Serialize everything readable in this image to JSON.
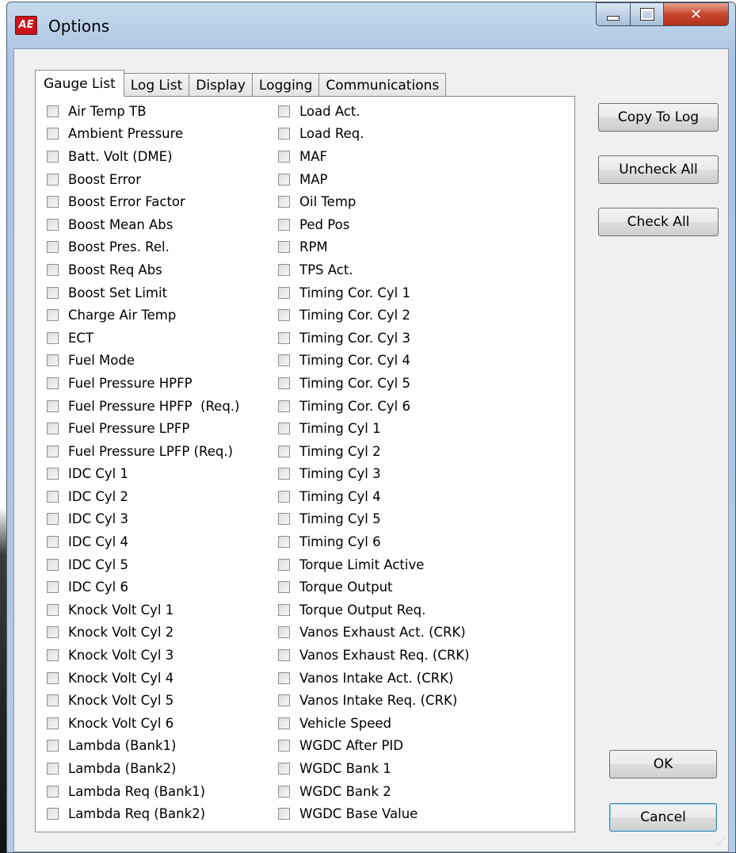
{
  "window": {
    "title": "Options",
    "icon_text": "AE"
  },
  "tabs": [
    "Gauge List",
    "Log List",
    "Display",
    "Logging",
    "Communications"
  ],
  "gauges_col1": [
    "Air Temp TB",
    "Ambient Pressure",
    "Batt. Volt (DME)",
    "Boost Error",
    "Boost Error Factor",
    "Boost Mean Abs",
    "Boost Pres. Rel.",
    "Boost Req Abs",
    "Boost Set Limit",
    "Charge Air Temp",
    "ECT",
    "Fuel Mode",
    "Fuel Pressure HPFP",
    "Fuel Pressure HPFP  (Req.)",
    "Fuel Pressure LPFP",
    "Fuel Pressure LPFP (Req.)",
    "IDC Cyl 1",
    "IDC Cyl 2",
    "IDC Cyl 3",
    "IDC Cyl 4",
    "IDC Cyl 5",
    "IDC Cyl 6",
    "Knock Volt Cyl 1",
    "Knock Volt Cyl 2",
    "Knock Volt Cyl 3",
    "Knock Volt Cyl 4",
    "Knock Volt Cyl 5",
    "Knock Volt Cyl 6",
    "Lambda (Bank1)",
    "Lambda (Bank2)",
    "Lambda Req (Bank1)",
    "Lambda Req (Bank2)"
  ],
  "gauges_col2": [
    "Load Act.",
    "Load Req.",
    "MAF",
    "MAP",
    "Oil Temp",
    "Ped Pos",
    "RPM",
    "TPS Act.",
    "Timing Cor. Cyl 1",
    "Timing Cor. Cyl 2",
    "Timing Cor. Cyl 3",
    "Timing Cor. Cyl 4",
    "Timing Cor. Cyl 5",
    "Timing Cor. Cyl 6",
    "Timing Cyl 1",
    "Timing Cyl 2",
    "Timing Cyl 3",
    "Timing Cyl 4",
    "Timing Cyl 5",
    "Timing Cyl 6",
    "Torque Limit Active",
    "Torque Output",
    "Torque Output Req.",
    "Vanos Exhaust Act. (CRK)",
    "Vanos Exhaust Req. (CRK)",
    "Vanos Intake Act. (CRK)",
    "Vanos Intake Req. (CRK)",
    "Vehicle Speed",
    "WGDC After PID",
    "WGDC Bank 1",
    "WGDC Bank 2",
    "WGDC Base Value"
  ],
  "buttons": {
    "copy_to_log": "Copy To Log",
    "uncheck_all": "Uncheck All",
    "check_all": "Check All",
    "ok": "OK",
    "cancel": "Cancel"
  }
}
